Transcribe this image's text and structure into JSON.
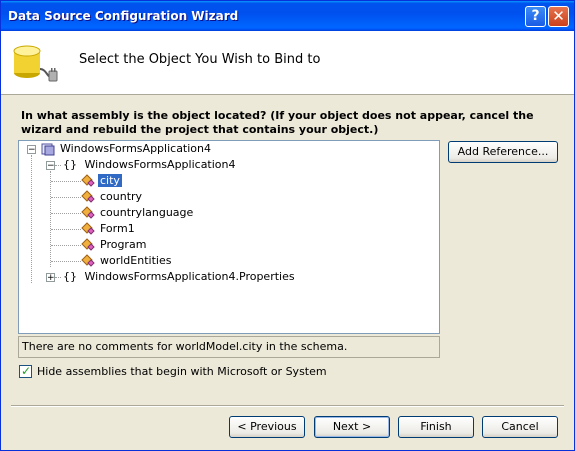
{
  "window": {
    "title": "Data Source Configuration Wizard"
  },
  "titlebar": {
    "help_glyph": "?",
    "close_glyph": "✕"
  },
  "header": {
    "title": "Select the Object You Wish to Bind to"
  },
  "prompt": "In what assembly is the object located? (If your object does not appear, cancel the wizard and rebuild the project that contains your object.)",
  "tree": {
    "root": "WindowsFormsApplication4",
    "namespace": "WindowsFormsApplication4",
    "classes": [
      "city",
      "country",
      "countrylanguage",
      "Form1",
      "Program",
      "worldEntities"
    ],
    "selected": "city",
    "namespace2": "WindowsFormsApplication4.Properties",
    "ns_glyph": "{}",
    "expanded_glyph": "−",
    "collapsed_glyph": "+"
  },
  "buttons": {
    "add_reference": "Add Reference...",
    "previous": "< Previous",
    "next": "Next >",
    "finish": "Finish",
    "cancel": "Cancel"
  },
  "status_text": "There are no comments for worldModel.city in the schema.",
  "hide_assemblies": {
    "label": "Hide assemblies that begin with Microsoft or System",
    "checked": true,
    "glyph": "✓"
  },
  "colors": {
    "selection": "#316ac5",
    "titlebar": "#0053ee",
    "face": "#ece9d8"
  }
}
